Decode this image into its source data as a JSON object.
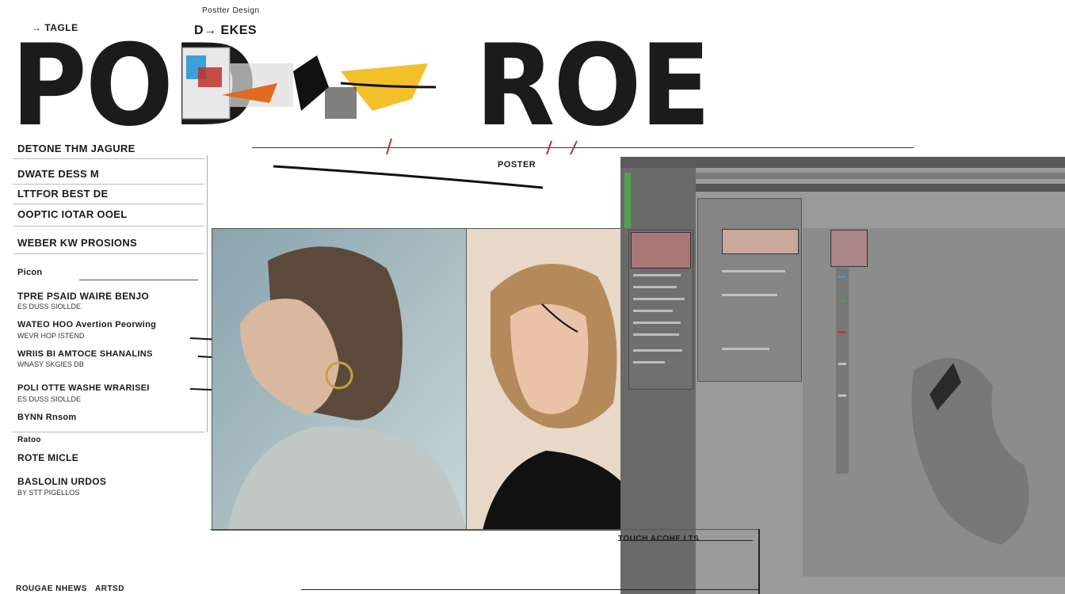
{
  "header": {
    "title": "POD",
    "title_right": "ROE",
    "small_text_top": "Postter Design",
    "small_text_left": "→ TAGLE",
    "small_text_center": "D→ EKES"
  },
  "overlay": {
    "label": "POSTER"
  },
  "sidebar": {
    "items": [
      {
        "label": "DETONE THM JAGURE",
        "sub": ""
      },
      {
        "label": "DWATE DESS M",
        "sub": ""
      },
      {
        "label": "LTTFOR BEST DE",
        "sub": ""
      },
      {
        "label": "OOPTIC IOTAR OOEL",
        "sub": ""
      },
      {
        "label": "WEBER KW PROSIONS",
        "sub": ""
      },
      {
        "label": "Picon",
        "sub": ""
      },
      {
        "label": "TPRE PSAID WAIRE BENJO",
        "sub": "ES DUSS SIOLLDE"
      },
      {
        "label": "WATEO HOO Avertion Peorwing",
        "sub": "WEVR HOP ISTEND"
      },
      {
        "label": "WRIIS BI AMTOCE SHANALINS",
        "sub": "WNASY SKGIES DB"
      },
      {
        "label": "POLI OTTE WASHE WRARISEI",
        "sub": "ES DUSS SIOLLDE"
      },
      {
        "label": "BYNN Rnsom",
        "sub": ""
      },
      {
        "label": "Ratoo",
        "sub": ""
      },
      {
        "label": "ROTE MICLE",
        "sub": ""
      },
      {
        "label": "BASLOLIN URDOS",
        "sub": "BY STT PIGELLOS"
      }
    ]
  },
  "bottom": {
    "caption": "TOUCH ACOHE LTS",
    "footer_left": "ROUGAE NHEWS",
    "footer_mid": "ARTSD"
  },
  "colors": {
    "accent_orange": "#f0a020",
    "accent_blue": "#3aa0d8",
    "accent_red": "#c0302a",
    "editor_bg": "#9a9a9a"
  }
}
